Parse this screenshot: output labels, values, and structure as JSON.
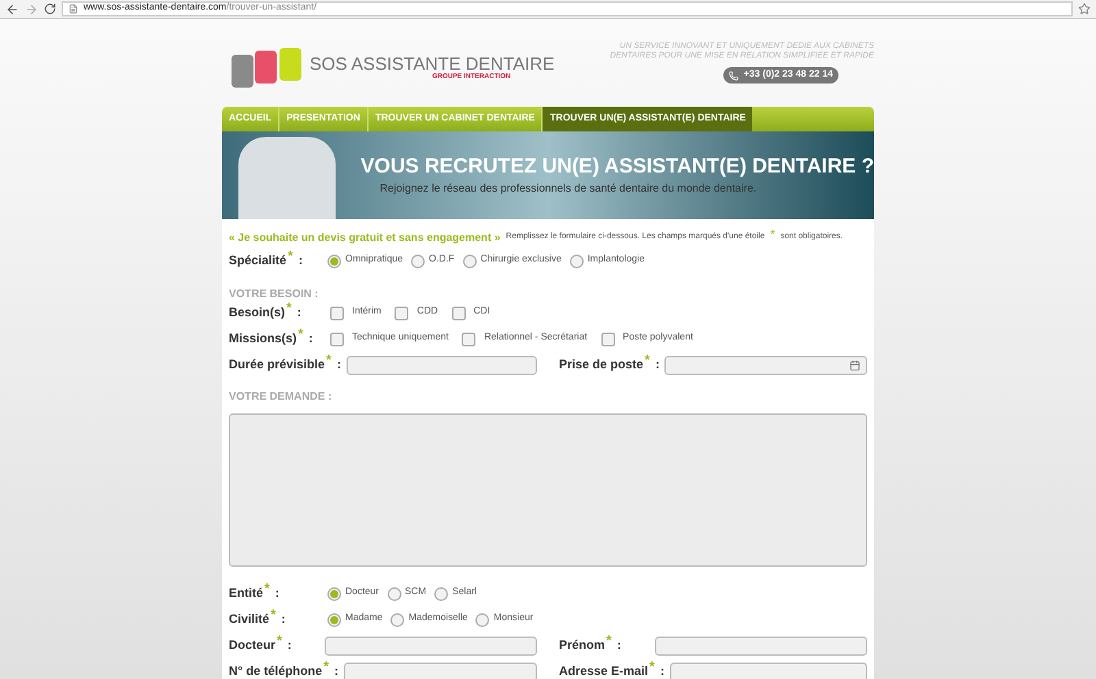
{
  "browser": {
    "url_domain": "www.sos-assistante-dentaire.com",
    "url_path": "/trouver-un-assistant/"
  },
  "header": {
    "brand": "SOS ASSISTANTE DENTAIRE",
    "group": "GROUPE INTERACTION",
    "tagline_1": "UN SERVICE INNOVANT ET UNIQUEMENT DEDIE AUX CABINETS",
    "tagline_2": "DENTAIRES POUR UNE MISE EN RELATION SIMPLIFIEE ET RAPIDE",
    "phone": "+33 (0)2 23 48 22 14"
  },
  "nav": [
    {
      "label": "ACCUEIL",
      "selected": false
    },
    {
      "label": "PRESENTATION",
      "selected": false
    },
    {
      "label": "TROUVER UN CABINET DENTAIRE",
      "selected": false
    },
    {
      "label": "TROUVER UN(E) ASSISTANT(E) DENTAIRE",
      "selected": true
    }
  ],
  "banner": {
    "title": "VOUS RECRUTEZ UN(E) ASSISTANT(E) DENTAIRE ?",
    "subtitle": "Rejoignez le réseau des professionnels de santé dentaire du monde dentaire."
  },
  "colon": ":",
  "intro": {
    "quote": "« Je souhaite un devis gratuit et sans engagement »",
    "note_1": "Remplissez le formulaire ci-dessous. Les champs marqués d'une étoile",
    "star": "*",
    "note_2": "sont obligatoires."
  },
  "rows": [
    {
      "kind": "radio",
      "label": "Spécialité",
      "required": true,
      "options": [
        {
          "label": "Omnipratique",
          "selected": true
        },
        {
          "label": "O.D.F",
          "selected": false
        },
        {
          "label": "Chirurgie exclusive",
          "selected": false
        },
        {
          "label": "Implantologie",
          "selected": false
        }
      ]
    },
    {
      "kind": "section",
      "label": "VOTRE BESOIN :"
    },
    {
      "kind": "checkbox",
      "label": "Besoin(s)",
      "required": true,
      "options": [
        {
          "label": "Intérim",
          "checked": false
        },
        {
          "label": "CDD",
          "checked": false
        },
        {
          "label": "CDI",
          "checked": false
        }
      ]
    },
    {
      "kind": "checkbox",
      "label": "Missions(s)",
      "required": true,
      "options": [
        {
          "label": "Technique uniquement",
          "checked": false
        },
        {
          "label": "Relationnel - Secrétariat",
          "checked": false
        },
        {
          "label": "Poste polyvalent",
          "checked": false
        }
      ]
    },
    {
      "kind": "fields",
      "fields": [
        {
          "label": "Durée prévisible",
          "required": true,
          "calendar": false
        },
        {
          "label": "Prise de poste",
          "required": true,
          "calendar": true
        }
      ]
    },
    {
      "kind": "section",
      "label": "VOTRE DEMANDE :"
    },
    {
      "kind": "textarea"
    },
    {
      "kind": "radio",
      "label": "Entité",
      "required": true,
      "options": [
        {
          "label": "Docteur",
          "selected": true
        },
        {
          "label": "SCM",
          "selected": false
        },
        {
          "label": "Selarl",
          "selected": false
        }
      ]
    },
    {
      "kind": "radio",
      "label": "Civilité",
      "required": true,
      "options": [
        {
          "label": "Madame",
          "selected": true
        },
        {
          "label": "Mademoiselle",
          "selected": false
        },
        {
          "label": "Monsieur",
          "selected": false
        }
      ]
    },
    {
      "kind": "fields",
      "fields": [
        {
          "label": "Docteur",
          "required": true,
          "calendar": false
        },
        {
          "label": "Prénom",
          "required": true,
          "calendar": false
        }
      ]
    },
    {
      "kind": "fields",
      "fields": [
        {
          "label": "N° de téléphone",
          "required": true,
          "calendar": false
        },
        {
          "label": "Adresse E-mail",
          "required": true,
          "calendar": false
        }
      ]
    }
  ]
}
